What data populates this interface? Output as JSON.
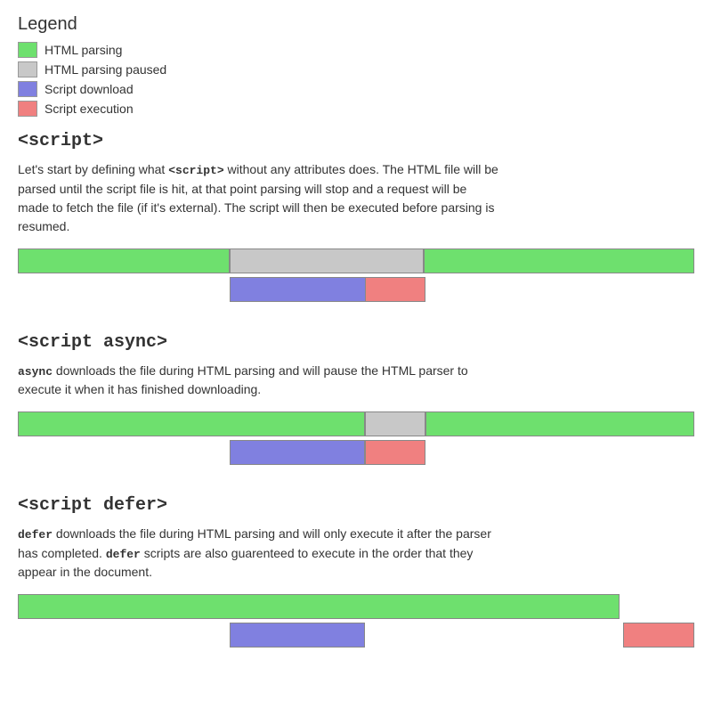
{
  "legend": {
    "title": "Legend",
    "items": [
      {
        "label": "HTML parsing",
        "color": "#6ee06e",
        "name": "html-parsing"
      },
      {
        "label": "HTML parsing paused",
        "color": "#c8c8c8",
        "name": "html-parsing-paused"
      },
      {
        "label": "Script download",
        "color": "#8080e0",
        "name": "script-download"
      },
      {
        "label": "Script execution",
        "color": "#f08080",
        "name": "script-execution"
      }
    ]
  },
  "sections": [
    {
      "id": "script",
      "heading": "<script>",
      "text_parts": [
        "Let's start by defining what ",
        "<script>",
        " without any attributes does. The HTML file will be parsed until the script file is hit, at that point parsing will stop and a request will be made to fetch the file (if it's external). The script will then be executed before parsing is resumed."
      ],
      "diagram": "script"
    },
    {
      "id": "script-async",
      "heading": "<script async>",
      "text_parts": [
        "async",
        " downloads the file during HTML parsing and will pause the HTML parser to execute it when it has finished downloading."
      ],
      "diagram": "async"
    },
    {
      "id": "script-defer",
      "heading": "<script defer>",
      "text_parts": [
        "defer",
        " downloads the file during HTML parsing and will only execute it after the parser has completed. ",
        "defer",
        " scripts are also guarenteed to execute in the order that they appear in the document."
      ],
      "diagram": "defer"
    }
  ]
}
